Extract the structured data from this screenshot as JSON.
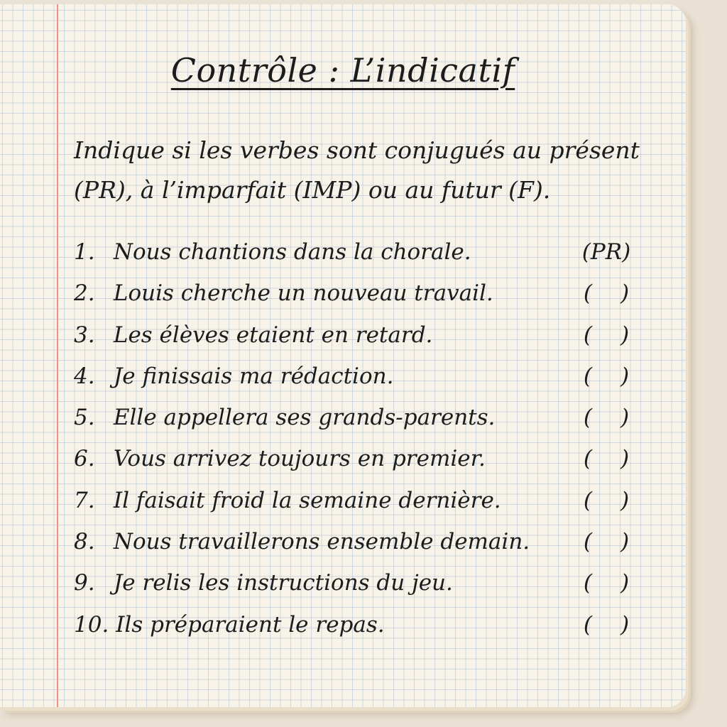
{
  "notebook": {
    "title": "Contrôle : L’indicatif",
    "instructions": "Indique si les verbes sont conjugués au présent (PR), à l’imparfait (IMP) ou au futur (F).",
    "items": [
      {
        "number": "1.",
        "sentence": "Nous chantions dans la chorale.",
        "answer": "PR"
      },
      {
        "number": "2.",
        "sentence": "Louis cherche un nouveau travail.",
        "answer": ""
      },
      {
        "number": "3.",
        "sentence": "Les élèves etaient en retard.",
        "answer": ""
      },
      {
        "number": "4.",
        "sentence": "Je finissais ma rédaction.",
        "answer": ""
      },
      {
        "number": "5.",
        "sentence": "Elle appellera ses grands-parents.",
        "answer": ""
      },
      {
        "number": "6.",
        "sentence": "Vous arrivez toujours en premier.",
        "answer": ""
      },
      {
        "number": "7.",
        "sentence": "Il faisait froid la semaine dernière.",
        "answer": ""
      },
      {
        "number": "8.",
        "sentence": "Nous travaillerons ensemble demain.",
        "answer": ""
      },
      {
        "number": "9.",
        "sentence": "Je relis les instructions du jeu.",
        "answer": ""
      },
      {
        "number": "10.",
        "sentence": "Ils préparaient le repas.",
        "answer": ""
      }
    ]
  },
  "colors": {
    "paper": "#f8f3e8",
    "grid": "#96afcd",
    "margin_line": "#ee8f8a",
    "ink": "#1c1c1c"
  }
}
